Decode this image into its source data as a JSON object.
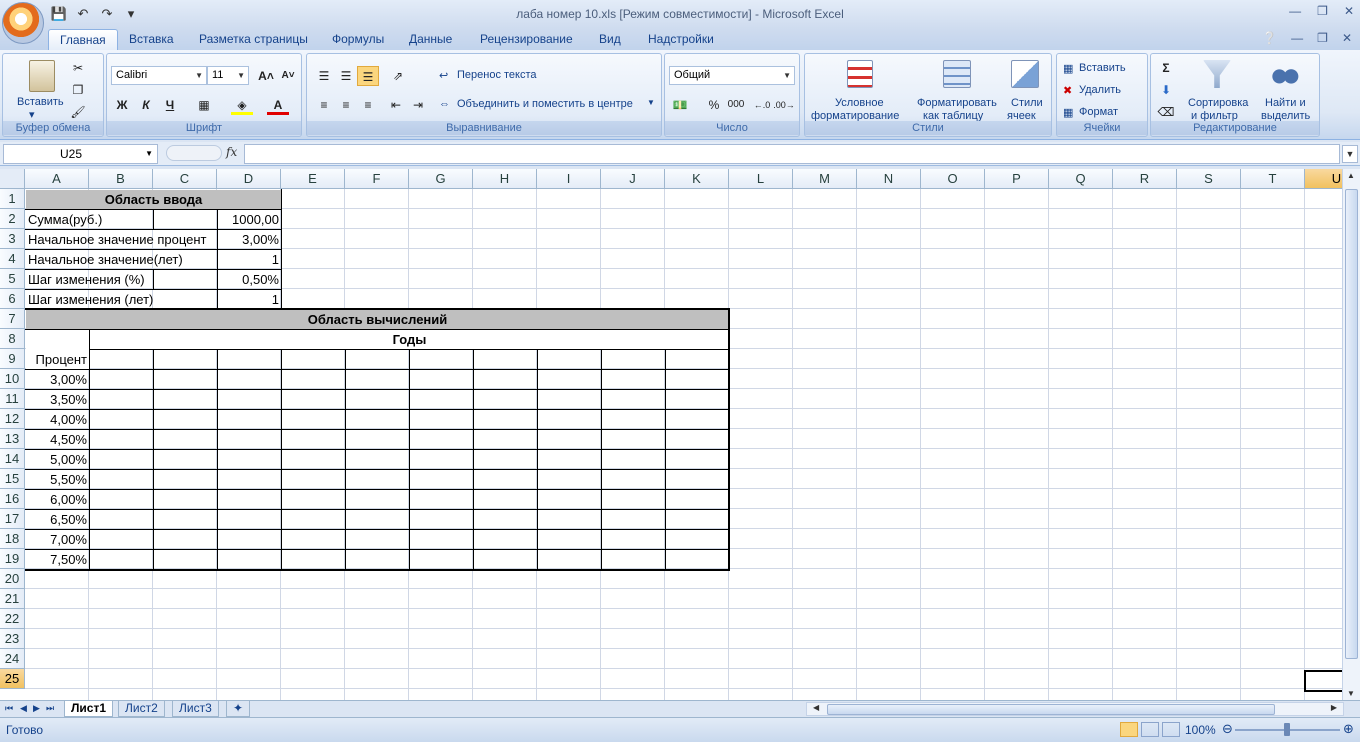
{
  "window": {
    "title": "лаба номер 10.xls  [Режим совместимости] - Microsoft Excel"
  },
  "ribbon_tabs": [
    "Главная",
    "Вставка",
    "Разметка страницы",
    "Формулы",
    "Данные",
    "Рецензирование",
    "Вид",
    "Надстройки"
  ],
  "ribbon": {
    "clipboard": {
      "label": "Буфер обмена",
      "paste": "Вставить"
    },
    "font": {
      "label": "Шрифт",
      "family": "Calibri",
      "size": "11",
      "bold": "Ж",
      "italic": "К",
      "underline": "Ч"
    },
    "alignment": {
      "label": "Выравнивание",
      "wrap": "Перенос текста",
      "merge": "Объединить и поместить в центре"
    },
    "number": {
      "label": "Число",
      "format": "Общий"
    },
    "styles": {
      "label": "Стили",
      "conditional_1": "Условное",
      "conditional_2": "форматирование",
      "table_1": "Форматировать",
      "table_2": "как таблицу",
      "cell_1": "Стили",
      "cell_2": "ячеек"
    },
    "cells": {
      "label": "Ячейки",
      "insert": "Вставить",
      "delete": "Удалить",
      "format": "Формат"
    },
    "editing": {
      "label": "Редактирование",
      "sort_1": "Сортировка",
      "sort_2": "и фильтр",
      "find_1": "Найти и",
      "find_2": "выделить"
    }
  },
  "formula_bar": {
    "name_box": "U25",
    "fx": "fx",
    "formula": ""
  },
  "columns": [
    "A",
    "B",
    "C",
    "D",
    "E",
    "F",
    "G",
    "H",
    "I",
    "J",
    "K",
    "L",
    "M",
    "N",
    "O",
    "P",
    "Q",
    "R",
    "S",
    "T",
    "U"
  ],
  "rows": [
    "1",
    "2",
    "3",
    "4",
    "5",
    "6",
    "7",
    "8",
    "9",
    "10",
    "11",
    "12",
    "13",
    "14",
    "15",
    "16",
    "17",
    "18",
    "19",
    "20",
    "21",
    "22",
    "23",
    "24",
    "25"
  ],
  "cells": {
    "input_title": "Область ввода",
    "sum_label": "Сумма(руб.)",
    "sum_value": "1000,00",
    "start_pct_label": "Начальное значение процент",
    "start_pct_value": "3,00%",
    "start_years_label": "Начальное значение(лет)",
    "start_years_value": "1",
    "step_pct_label": "Шаг изменения (%)",
    "step_pct_value": "0,50%",
    "step_years_label": "Шаг изменения (лет)",
    "step_years_value": "1",
    "calc_title": "Область вычислений",
    "years_header": "Годы",
    "percent_header": "Процент",
    "percents": [
      "3,00%",
      "3,50%",
      "4,00%",
      "4,50%",
      "5,00%",
      "5,50%",
      "6,00%",
      "6,50%",
      "7,00%",
      "7,50%"
    ]
  },
  "sheets": [
    "Лист1",
    "Лист2",
    "Лист3"
  ],
  "active_sheet": "Лист1",
  "status": {
    "text": "Готово",
    "zoom": "100%"
  },
  "colors": {
    "selected_header": "#f1c15f",
    "gray_fill": "#bfbfbf",
    "ribbon_text": "#15428b"
  }
}
